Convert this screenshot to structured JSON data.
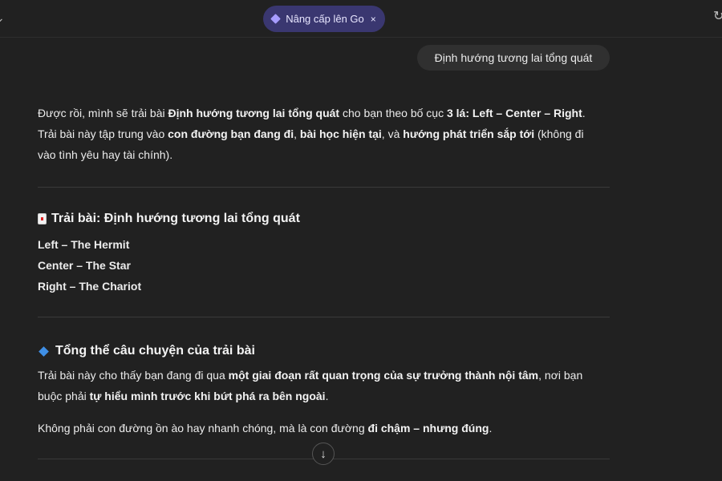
{
  "topbar": {
    "upgrade_label": "Nâng cấp lên Go",
    "close_glyph": "×",
    "left_icon": "chevron-icon",
    "right_icon": "refresh-icon"
  },
  "user_message": "Định hướng tương lai tổng quát",
  "reply": {
    "intro": [
      {
        "t": "Được rồi, mình sẽ trải bài ",
        "b": false
      },
      {
        "t": "Định hướng tương lai tổng quát",
        "b": true
      },
      {
        "t": " cho bạn theo bố cục ",
        "b": false
      },
      {
        "t": "3 lá: Left – Center – Right",
        "b": true
      },
      {
        "t": ".",
        "b": false
      },
      {
        "br": true
      },
      {
        "t": "Trải bài này tập trung vào ",
        "b": false
      },
      {
        "t": "con đường bạn đang đi",
        "b": true
      },
      {
        "t": ", ",
        "b": false
      },
      {
        "t": "bài học hiện tại",
        "b": true
      },
      {
        "t": ", và ",
        "b": false
      },
      {
        "t": "hướng phát triển sắp tới",
        "b": true
      },
      {
        "t": " (không đi",
        "b": false
      },
      {
        "br": true
      },
      {
        "t": "vào tình yêu hay tài chính).",
        "b": false
      }
    ],
    "spread_heading": "Trải bài: Định hướng tương lai tổng quát",
    "cards": [
      "Left – The Hermit",
      "Center – The Star",
      "Right – The Chariot"
    ],
    "story_heading": "Tổng thể câu chuyện của trải bài",
    "story_p1": [
      {
        "t": "Trải bài này cho thấy bạn đang đi qua ",
        "b": false
      },
      {
        "t": "một giai đoạn rất quan trọng của sự trưởng thành nội tâm",
        "b": true
      },
      {
        "t": ", nơi bạn",
        "b": false
      },
      {
        "br": true
      },
      {
        "t": "buộc phải ",
        "b": false
      },
      {
        "t": "tự hiểu mình trước khi bứt phá ra bên ngoài",
        "b": true
      },
      {
        "t": ".",
        "b": false
      }
    ],
    "story_p2": [
      {
        "t": "Không phải con đường ồn ào hay nhanh chóng, mà là con đường ",
        "b": false
      },
      {
        "t": "đi chậm – nhưng đúng",
        "b": true
      },
      {
        "t": ".",
        "b": false
      }
    ]
  },
  "scroll_down_glyph": "↓",
  "colors": {
    "background": "#212121",
    "upgrade_pill": "#3a3770",
    "user_bubble": "#303030",
    "accent_diamond": "#3f8fe6"
  }
}
